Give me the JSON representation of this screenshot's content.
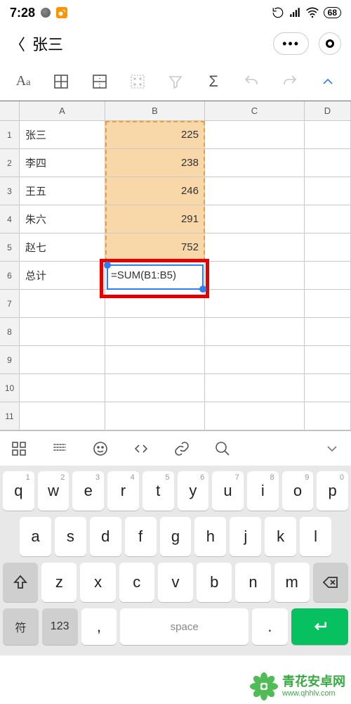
{
  "status": {
    "time": "7:28",
    "battery": "68"
  },
  "title": "张三",
  "toolbar_icons": {
    "aa": "Aa",
    "sigma": "Σ"
  },
  "columns": [
    "A",
    "B",
    "C",
    "D"
  ],
  "rows": [
    {
      "n": "1",
      "A": "张三",
      "B": "225"
    },
    {
      "n": "2",
      "A": "李四",
      "B": "238"
    },
    {
      "n": "3",
      "A": "王五",
      "B": "246"
    },
    {
      "n": "4",
      "A": "朱六",
      "B": "291"
    },
    {
      "n": "5",
      "A": "赵七",
      "B": "752"
    },
    {
      "n": "6",
      "A": "总计",
      "B": "=SUM(B1:B5)"
    },
    {
      "n": "7",
      "A": "",
      "B": ""
    },
    {
      "n": "8",
      "A": "",
      "B": ""
    },
    {
      "n": "9",
      "A": "",
      "B": ""
    },
    {
      "n": "10",
      "A": "",
      "B": ""
    },
    {
      "n": "11",
      "A": "",
      "B": ""
    }
  ],
  "keyboard": {
    "row1": [
      {
        "sup": "1",
        "main": "q"
      },
      {
        "sup": "2",
        "main": "w"
      },
      {
        "sup": "3",
        "main": "e"
      },
      {
        "sup": "4",
        "main": "r"
      },
      {
        "sup": "5",
        "main": "t"
      },
      {
        "sup": "6",
        "main": "y"
      },
      {
        "sup": "7",
        "main": "u"
      },
      {
        "sup": "8",
        "main": "i"
      },
      {
        "sup": "9",
        "main": "o"
      },
      {
        "sup": "0",
        "main": "p"
      }
    ],
    "row2": [
      {
        "main": "a"
      },
      {
        "main": "s"
      },
      {
        "main": "d"
      },
      {
        "main": "f"
      },
      {
        "main": "g"
      },
      {
        "main": "h"
      },
      {
        "main": "j"
      },
      {
        "main": "k"
      },
      {
        "main": "l"
      }
    ],
    "row3": [
      {
        "main": "z"
      },
      {
        "main": "x"
      },
      {
        "main": "c"
      },
      {
        "main": "v"
      },
      {
        "main": "b"
      },
      {
        "main": "n"
      },
      {
        "main": "m"
      }
    ],
    "func": {
      "sym": "符",
      "num": "123",
      "comma": ",",
      "space": "space",
      "dot": "."
    }
  },
  "watermark": {
    "cn": "青花安卓网",
    "en": "www.qhhlv.com"
  }
}
